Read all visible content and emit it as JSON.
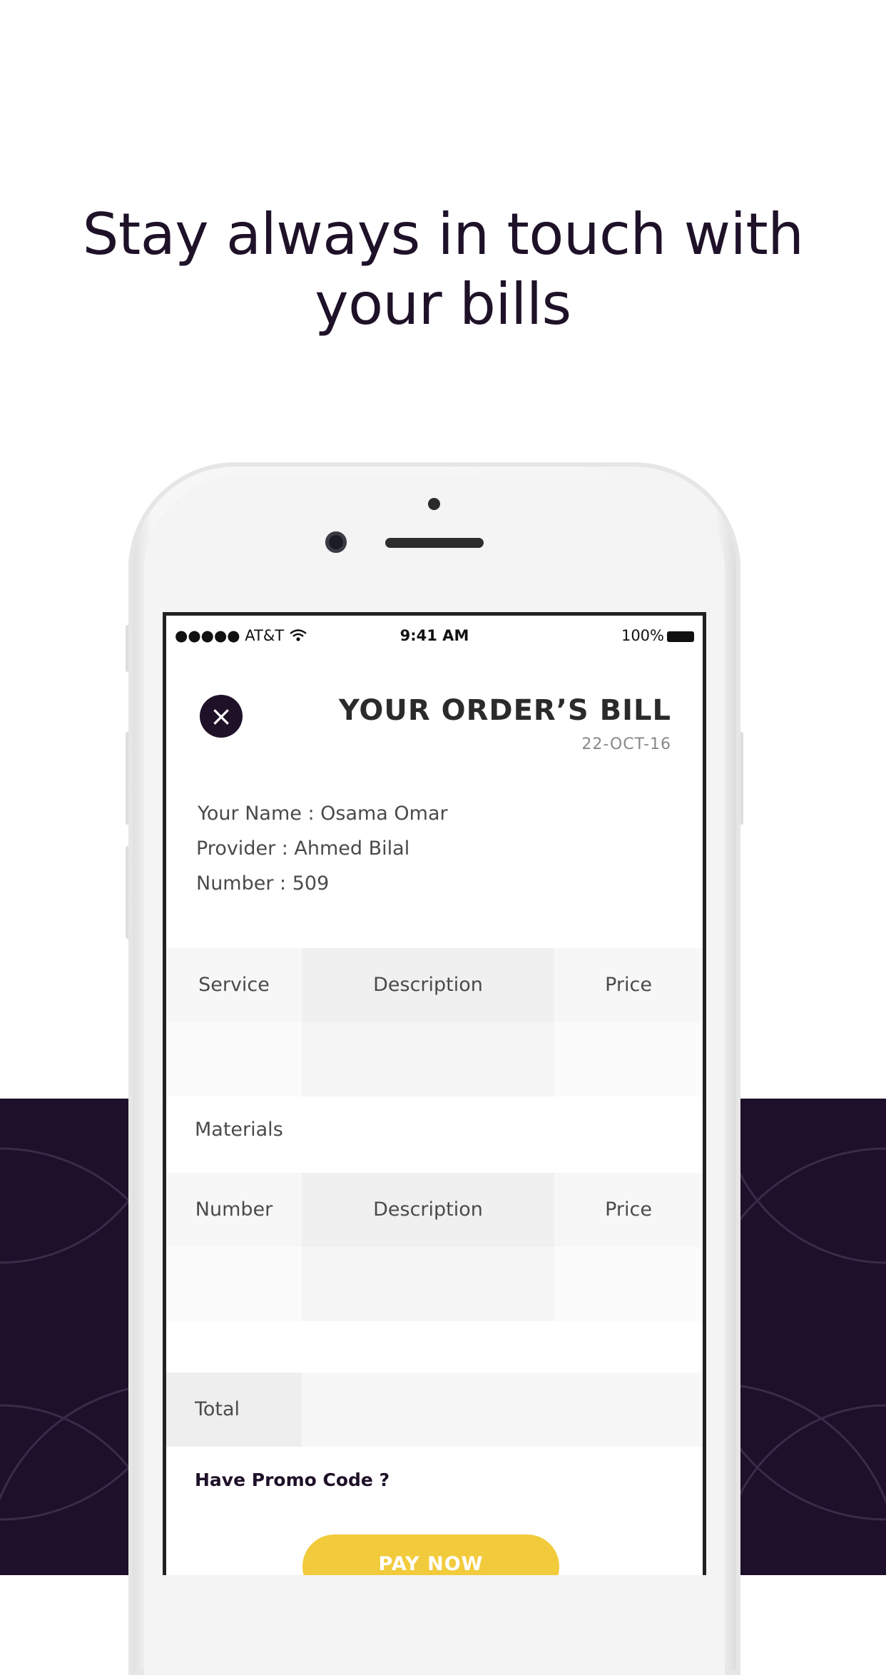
{
  "headline": {
    "line1": "Stay always in touch with",
    "line2": "your bills"
  },
  "status_bar": {
    "carrier": "●●●●● AT&T",
    "time": "9:41 AM",
    "battery": "100%"
  },
  "bill": {
    "close_icon": "×",
    "title": "YOUR ORDER’S BILL",
    "date": "22-OCT-16",
    "name_line": "Your Name : Osama Omar",
    "provider_line": "Provider : Ahmed Bilal",
    "number_line": "Number : 509"
  },
  "services_table": {
    "headers": [
      "Service",
      "Description",
      "Price"
    ]
  },
  "materials": {
    "label": "Materials",
    "headers": [
      "Number",
      "Description",
      "Price"
    ]
  },
  "total_label": "Total",
  "promo_label": "Have Promo Code ?",
  "pay_button": "PAY NOW",
  "colors": {
    "brand_dark": "#1e1128",
    "accent_yellow": "#f2cb3d"
  },
  "icons": {
    "close": "close-icon",
    "wifi": "wifi-icon",
    "battery": "battery-icon"
  }
}
